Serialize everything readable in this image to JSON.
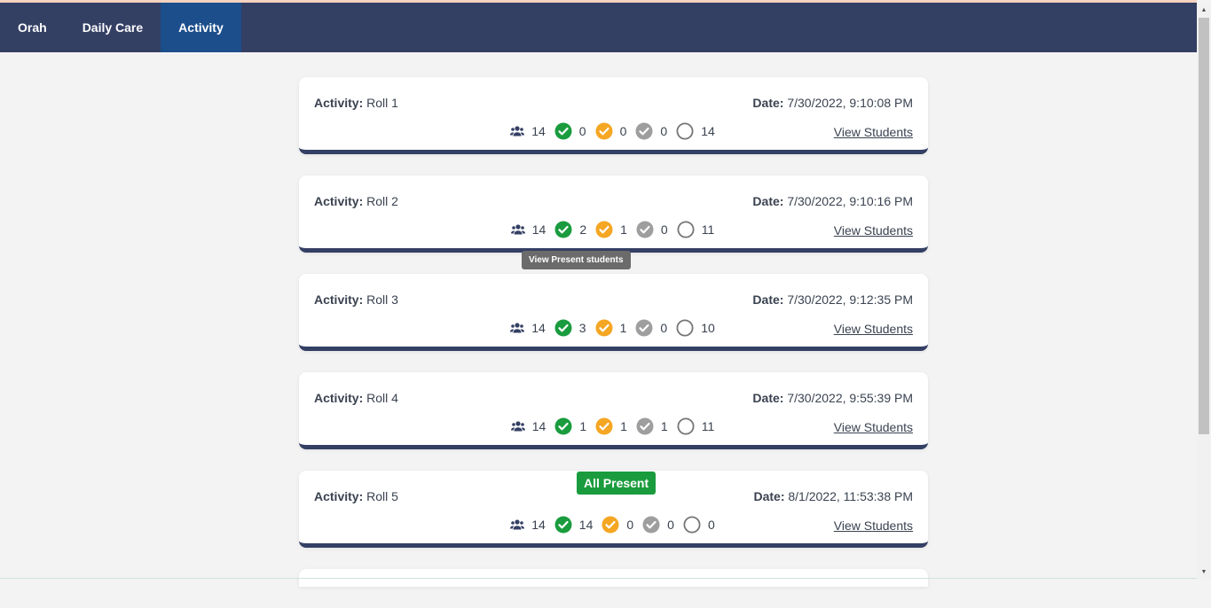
{
  "nav": {
    "items": [
      {
        "label": "Orah"
      },
      {
        "label": "Daily Care"
      },
      {
        "label": "Activity"
      }
    ]
  },
  "labels": {
    "activity": "Activity:",
    "date": "Date:",
    "view_students": "View Students"
  },
  "colors": {
    "navbar": "#343f64",
    "nav_active": "#1c4e8c",
    "present": "#1a9c3e",
    "late": "#f5a623",
    "absent": "#9e9e9e",
    "unmarked": "#757575"
  },
  "tooltip": "View Present students",
  "badge": "All Present",
  "rolls": [
    {
      "name": "Roll 1",
      "date": "7/30/2022, 9:10:08 PM",
      "total": "14",
      "present": "0",
      "late": "0",
      "absent": "0",
      "unmarked": "14"
    },
    {
      "name": "Roll 2",
      "date": "7/30/2022, 9:10:16 PM",
      "total": "14",
      "present": "2",
      "late": "1",
      "absent": "0",
      "unmarked": "11"
    },
    {
      "name": "Roll 3",
      "date": "7/30/2022, 9:12:35 PM",
      "total": "14",
      "present": "3",
      "late": "1",
      "absent": "0",
      "unmarked": "10"
    },
    {
      "name": "Roll 4",
      "date": "7/30/2022, 9:55:39 PM",
      "total": "14",
      "present": "1",
      "late": "1",
      "absent": "1",
      "unmarked": "11"
    },
    {
      "name": "Roll 5",
      "date": "8/1/2022, 11:53:38 PM",
      "total": "14",
      "present": "14",
      "late": "0",
      "absent": "0",
      "unmarked": "0"
    }
  ]
}
